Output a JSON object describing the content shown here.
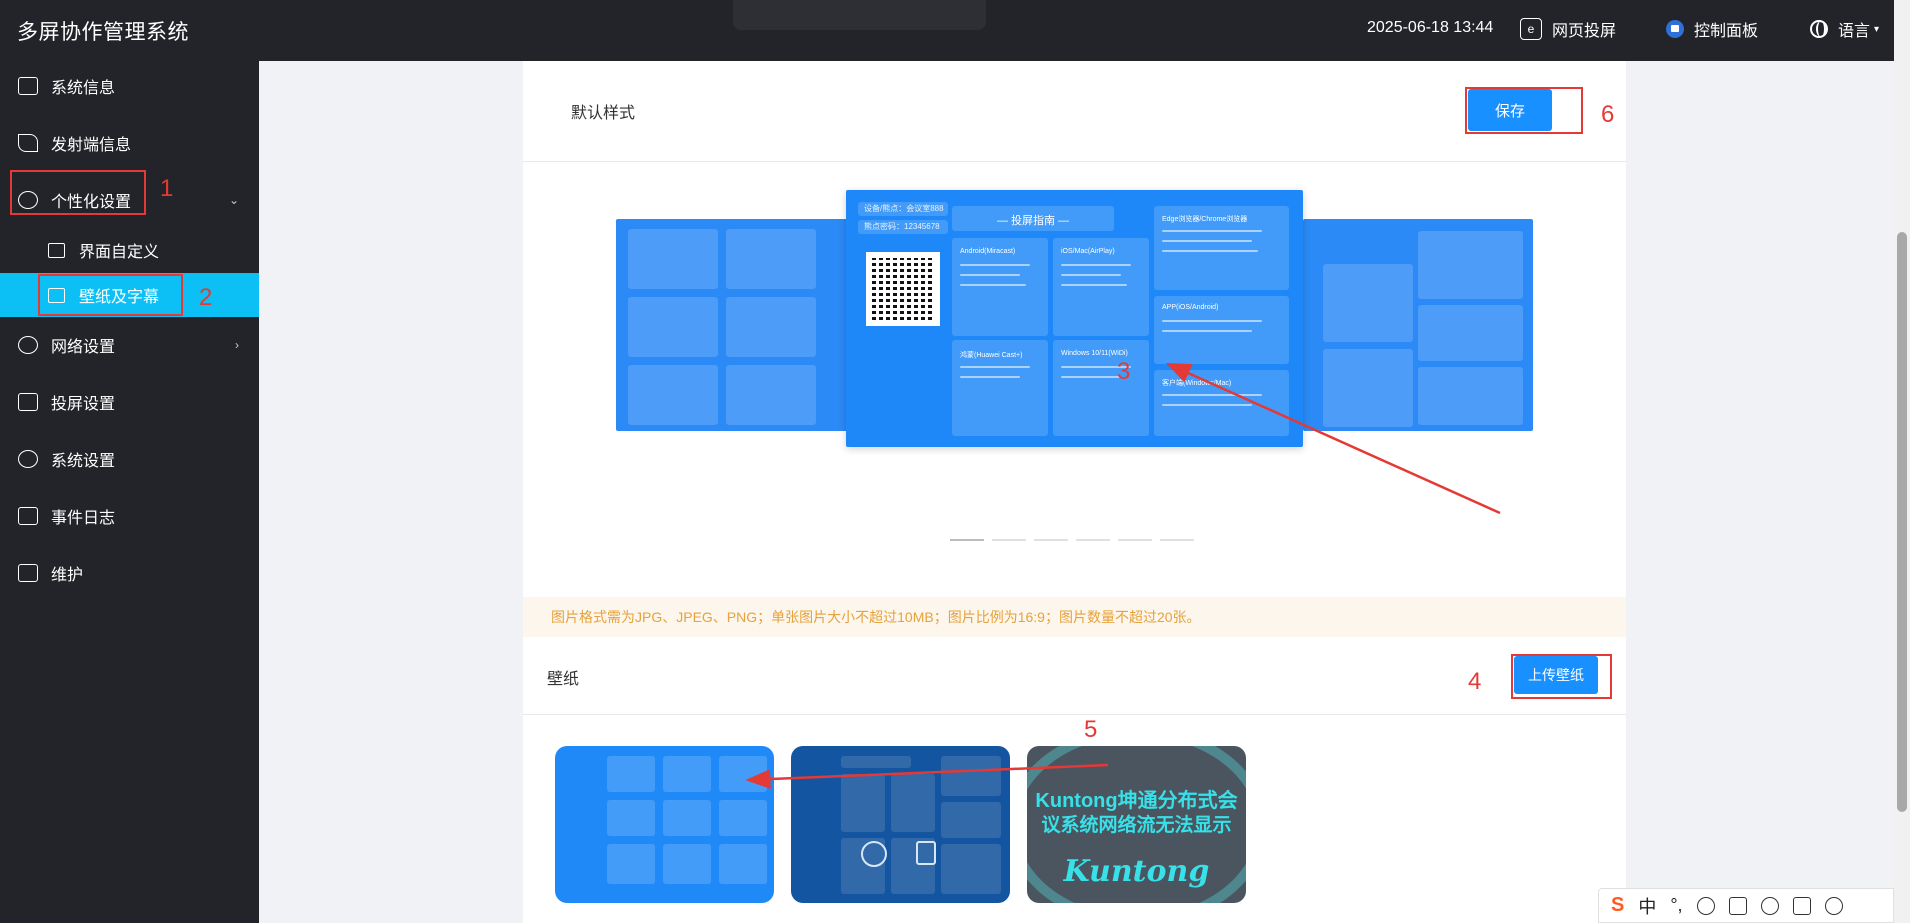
{
  "app": {
    "title": "多屏协作管理系统"
  },
  "header": {
    "datetime": "2025-06-18 13:44",
    "webcast_label": "网页投屏",
    "webcast_icon_text": "e",
    "control_panel_label": "控制面板",
    "language_label": "语言",
    "language_caret": "▾"
  },
  "sidebar": {
    "items": [
      {
        "label": "系统信息",
        "icon": "info-icon"
      },
      {
        "label": "发射端信息",
        "icon": "send-icon"
      },
      {
        "label": "个性化设置",
        "icon": "personalize-icon",
        "chevron": "⌄"
      },
      {
        "label": "网络设置",
        "icon": "globe-icon",
        "chevron": "›"
      },
      {
        "label": "投屏设置",
        "icon": "cast-icon"
      },
      {
        "label": "系统设置",
        "icon": "settings-icon"
      },
      {
        "label": "事件日志",
        "icon": "log-icon"
      },
      {
        "label": "维护",
        "icon": "maintenance-icon"
      }
    ],
    "sub_items": [
      {
        "label": "界面自定义",
        "icon": "window-icon"
      },
      {
        "label": "壁纸及字幕",
        "icon": "image-icon",
        "active": true
      }
    ]
  },
  "main": {
    "style_section_title": "默认样式",
    "save_label": "保存",
    "notice": "图片格式需为JPG、JPEG、PNG；单张图片大小不超过10MB；图片比例为16:9；图片数量不超过20张。",
    "wallpaper_title": "壁纸",
    "upload_label": "上传壁纸",
    "carousel_pages": 6,
    "carousel_active_page": 1,
    "preview_center": {
      "guide_title": "— 投屏指南 —",
      "device_line": "设备/熊点：会议室888",
      "code_line": "熊点密码：12345678",
      "panels": [
        "Android(Miracast)",
        "iOS/Mac(AirPlay)",
        "Edge浏览器/Chrome浏览器",
        "鸿蒙(Huawei Cast+)",
        "Windows 10/11(WiDi)",
        "APP(iOS/Android)",
        "客户端(Windows/Mac)"
      ]
    },
    "thumb3_brand": {
      "line1": "Kuntong坤通分布式会",
      "line2": "议系统网络流无法显示",
      "line3": "Kuntong"
    }
  },
  "annotations": {
    "color": "#e53935",
    "numbers": [
      "1",
      "2",
      "3",
      "4",
      "5",
      "6"
    ]
  },
  "ime": {
    "logo": "S",
    "mode": "中",
    "punct": "°,"
  }
}
